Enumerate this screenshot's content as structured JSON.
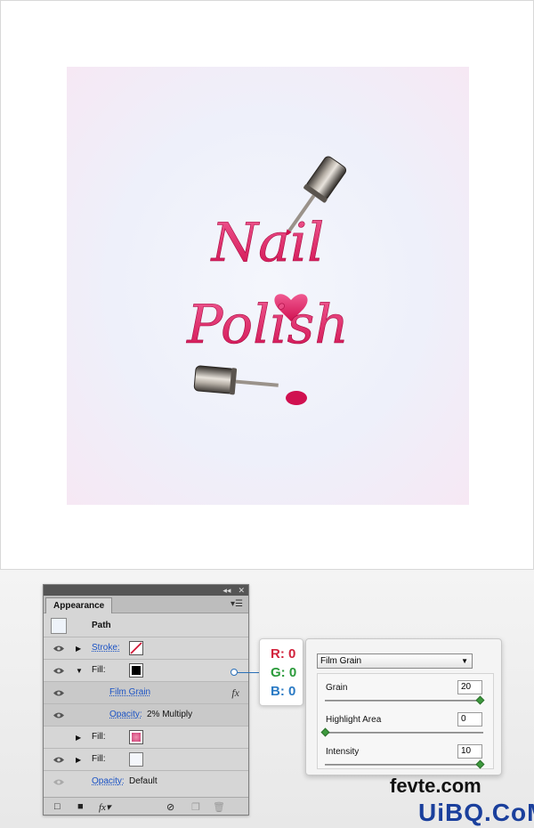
{
  "artwork": {
    "line1": "Nail",
    "line2": "Polish"
  },
  "panel": {
    "tab": "Appearance",
    "rows": [
      {
        "label": "Path"
      },
      {
        "label": "Stroke:"
      },
      {
        "label": "Fill:"
      },
      {
        "label": "Film Grain"
      },
      {
        "label": "Opacity:",
        "value": "2% Multiply"
      },
      {
        "label": "Fill:"
      },
      {
        "label": "Fill:"
      },
      {
        "label": "Opacity:",
        "value": "Default"
      }
    ],
    "fx": "fx"
  },
  "rgb": {
    "r": "R: 0",
    "g": "G: 0",
    "b": "B: 0",
    "colors": {
      "r": "#d2233c",
      "g": "#2a9a3a",
      "b": "#2a7ac4"
    }
  },
  "film_grain": {
    "filter": "Film Grain",
    "sliders": [
      {
        "label": "Grain",
        "value": "20",
        "level": 1.0
      },
      {
        "label": "Highlight Area",
        "value": "0",
        "level": 0.0
      },
      {
        "label": "Intensity",
        "value": "10",
        "level": 1.0
      }
    ]
  },
  "watermark": {
    "line1": "fevte.com",
    "line2": "UiBQ.CoM"
  }
}
